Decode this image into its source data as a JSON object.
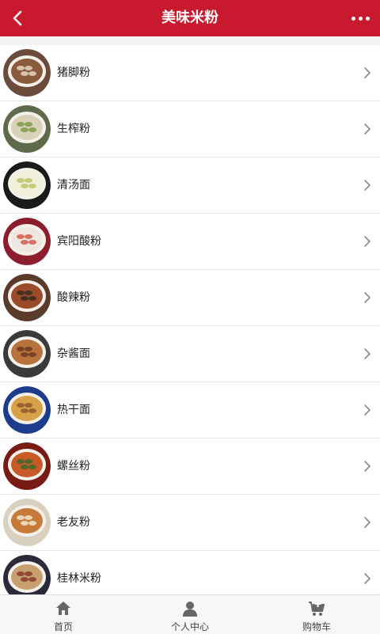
{
  "header": {
    "title": "美味米粉",
    "back_icon": "chevron-left-icon",
    "more_icon": "more-dots-icon",
    "background_color": "#c8192e"
  },
  "food_list": [
    {
      "name": "猪脚粉",
      "bowl": "#6b4b3a",
      "broth": "#8a5a3c",
      "topping": "#e3d6c0"
    },
    {
      "name": "生榨粉",
      "bowl": "#5f6a4a",
      "broth": "#d9d2b8",
      "topping": "#7d9a4a"
    },
    {
      "name": "清汤面",
      "bowl": "#1a1a1a",
      "broth": "#f1f0d8",
      "topping": "#b7c66a"
    },
    {
      "name": "宾阳酸粉",
      "bowl": "#8b1d2c",
      "broth": "#f0e6e0",
      "topping": "#d45a4a"
    },
    {
      "name": "酸辣粉",
      "bowl": "#5a3a2a",
      "broth": "#9b4a2a",
      "topping": "#3a2a1e"
    },
    {
      "name": "杂酱面",
      "bowl": "#3a3a3a",
      "broth": "#b8733c",
      "topping": "#6b3a1e"
    },
    {
      "name": "热干面",
      "bowl": "#1e3c8c",
      "broth": "#d9a04a",
      "topping": "#8a5a2a"
    },
    {
      "name": "螺丝粉",
      "bowl": "#7a1a14",
      "broth": "#c85a2a",
      "topping": "#3a6a2a"
    },
    {
      "name": "老友粉",
      "bowl": "#d9d0c0",
      "broth": "#c87a3a",
      "topping": "#f0e6d0"
    },
    {
      "name": "桂林米粉",
      "bowl": "#2a2a3a",
      "broth": "#c8a070",
      "topping": "#8a3a2a"
    }
  ],
  "tabbar": {
    "items": [
      {
        "label": "首页",
        "icon": "home-icon"
      },
      {
        "label": "个人中心",
        "icon": "user-icon"
      },
      {
        "label": "购物车",
        "icon": "cart-icon"
      }
    ]
  }
}
